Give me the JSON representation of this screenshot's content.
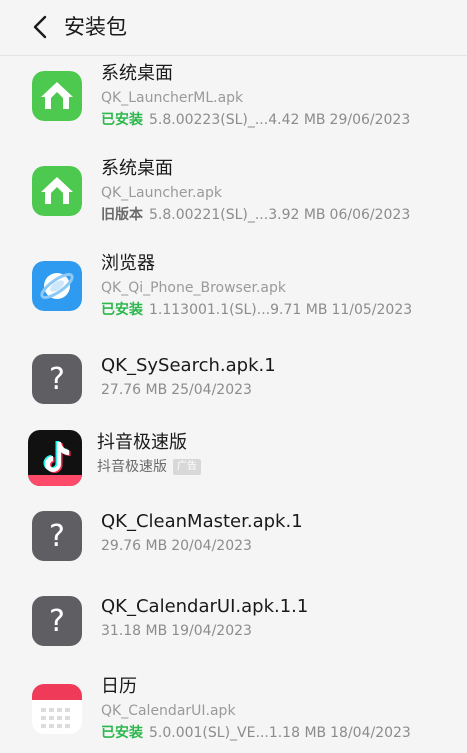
{
  "header": {
    "title": "安装包"
  },
  "colors": {
    "installed": "#2db84d",
    "background": "#f5f5f5",
    "secondary_text": "#9a9a9a"
  },
  "items": [
    {
      "name": "系统桌面",
      "file": "QK_LauncherML.apk",
      "status": "已安装",
      "version": "5.8.00223(SL)_...",
      "size": "4.42 MB",
      "date": "29/06/2023",
      "icon": "home-app-icon"
    },
    {
      "name": "系统桌面",
      "file": "QK_Launcher.apk",
      "status": "旧版本",
      "version": "5.8.00221(SL)_...",
      "size": "3.92 MB",
      "date": "06/06/2023",
      "icon": "home-app-icon"
    },
    {
      "name": "浏览器",
      "file": "QK_Qi_Phone_Browser.apk",
      "status": "已安装",
      "version": "1.113001.1(SL)...",
      "size": "9.71 MB",
      "date": "11/05/2023",
      "icon": "browser-app-icon"
    },
    {
      "name": "QK_SySearch.apk.1",
      "size": "27.76 MB",
      "date": "25/04/2023",
      "icon": "unknown-file-icon"
    },
    {
      "name": "抖音极速版",
      "subtitle": "抖音极速版",
      "ad_label": "广告",
      "icon": "douyin-app-icon"
    },
    {
      "name": "QK_CleanMaster.apk.1",
      "size": "29.76 MB",
      "date": "20/04/2023",
      "icon": "unknown-file-icon"
    },
    {
      "name": "QK_CalendarUI.apk.1.1",
      "size": "31.18 MB",
      "date": "19/04/2023",
      "icon": "unknown-file-icon"
    },
    {
      "name": "日历",
      "file": "QK_CalendarUI.apk",
      "status": "已安装",
      "version": "5.0.001(SL)_VE...",
      "size": "1.18 MB",
      "date": "18/04/2023",
      "icon": "calendar-app-icon"
    }
  ]
}
